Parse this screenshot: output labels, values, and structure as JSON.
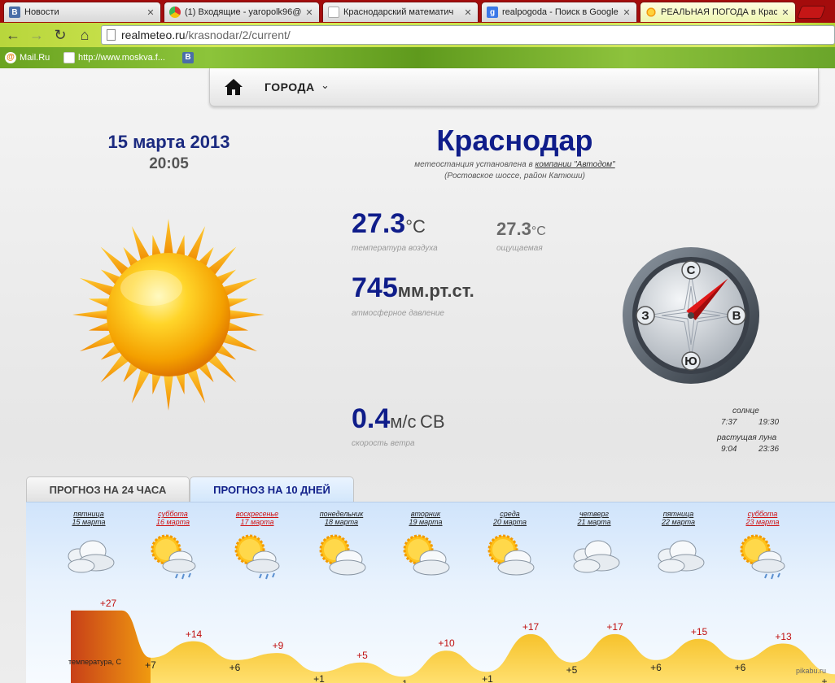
{
  "browser": {
    "tabs": [
      {
        "title": "Новости",
        "favicon": "vk-icon"
      },
      {
        "title": "(1) Входящие - yaropolk96@",
        "favicon": "chrome-icon"
      },
      {
        "title": "Краснодарский математич",
        "favicon": "document-icon"
      },
      {
        "title": "realpogoda - Поиск в Google",
        "favicon": "google-icon"
      },
      {
        "title": "РЕАЛЬНАЯ ПОГОДА в Крас",
        "favicon": "sun-icon"
      }
    ],
    "url_host": "realmeteo.ru",
    "url_path": "/krasnodar/2/current/",
    "bookmarks": [
      "Mail.Ru",
      "http://www.moskva.f..."
    ]
  },
  "nav": {
    "cities_label": "ГОРОДА"
  },
  "current": {
    "date": "15 марта 2013",
    "time": "20:05",
    "city": "Краснодар",
    "station_line_prefix": "метеостанция установлена в",
    "station_company": "компании \"Автодом\"",
    "station_location": "(Ростовское шоссе, район Катюши)",
    "temperature": "27.3",
    "temperature_unit": "°С",
    "temperature_caption": "температура воздуха",
    "feels_like": "27.3",
    "feels_like_unit": "°С",
    "feels_like_caption": "ощущаемая",
    "pressure": "745",
    "pressure_unit": "мм.рт.ст.",
    "pressure_caption": "атмосферное давление",
    "wind_speed": "0.4",
    "wind_unit": "м/с",
    "wind_dir": "СВ",
    "wind_caption": "скорость ветра",
    "compass": {
      "n": "С",
      "s": "Ю",
      "w": "З",
      "e": "В",
      "wind_bearing_deg": 45
    },
    "sun_label": "солнце",
    "sunrise": "7:37",
    "sunset": "19:30",
    "moon_label": "растущая луна",
    "moonrise": "9:04",
    "moonset": "23:36"
  },
  "forecast_tabs": [
    "ПРОГНОЗ НА 24 ЧАСА",
    "ПРОГНОЗ НА 10 ДНЕЙ"
  ],
  "forecast_days": [
    {
      "weekday": "пятница",
      "date": "15 марта",
      "weekend": false,
      "icon": "cloudy-icon"
    },
    {
      "weekday": "суббота",
      "date": "16 марта",
      "weekend": true,
      "icon": "sun-cloud-rain-icon"
    },
    {
      "weekday": "воскресенье",
      "date": "17 марта",
      "weekend": true,
      "icon": "sun-cloud-rain-icon"
    },
    {
      "weekday": "понедельник",
      "date": "18 марта",
      "weekend": false,
      "icon": "sun-cloud-icon"
    },
    {
      "weekday": "вторник",
      "date": "19 марта",
      "weekend": false,
      "icon": "sun-cloud-icon"
    },
    {
      "weekday": "среда",
      "date": "20 марта",
      "weekend": false,
      "icon": "sun-cloud-icon"
    },
    {
      "weekday": "четверг",
      "date": "21 марта",
      "weekend": false,
      "icon": "cloudy-icon"
    },
    {
      "weekday": "пятница",
      "date": "22 марта",
      "weekend": false,
      "icon": "cloudy-icon"
    },
    {
      "weekday": "суббота",
      "date": "23 марта",
      "weekend": true,
      "icon": "sun-cloud-rain-icon"
    }
  ],
  "temp_graph_label": "температура, С",
  "temp_day": [
    "+27",
    "+14",
    "+9",
    "+5",
    "+10",
    "+17",
    "+17",
    "+15",
    "+13"
  ],
  "temp_night": [
    "+7",
    "+6",
    "+1",
    "-1",
    "+1",
    "+5",
    "+6",
    "+6",
    "+"
  ],
  "chart_data": {
    "type": "area",
    "ylabel": "температура, С",
    "x": [
      "15 марта",
      "16 марта",
      "17 марта",
      "18 марта",
      "19 марта",
      "20 марта",
      "21 марта",
      "22 марта",
      "23 марта"
    ],
    "series": [
      {
        "values": [
          27,
          14,
          9,
          5,
          10,
          17,
          17,
          15,
          13
        ]
      },
      {
        "values": [
          7,
          6,
          1,
          -1,
          1,
          5,
          6,
          6
        ]
      }
    ]
  },
  "credit": "pikabu.ru",
  "colors": {
    "title_blue": "#0f1d8a",
    "weekend_red": "#d01010",
    "tab_strip": "#a40c0c"
  }
}
